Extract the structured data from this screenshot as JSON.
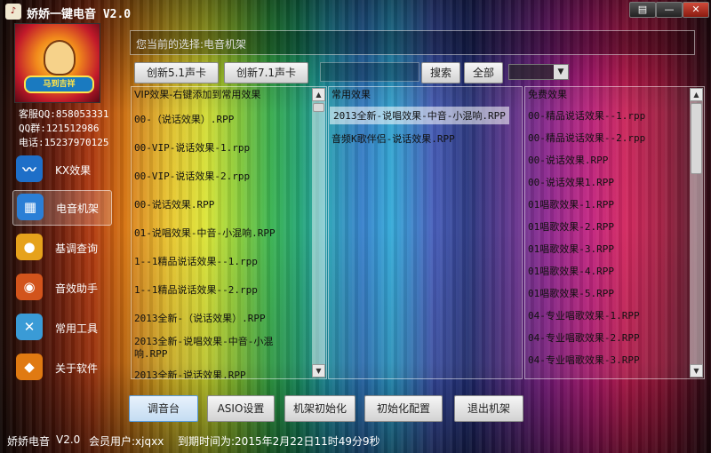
{
  "app": {
    "title": "娇娇一键电音 V2.0",
    "logo_icon": "app-logo-icon",
    "avatar_text": "马到吉祥"
  },
  "window_controls": [
    {
      "name": "menu-icon",
      "glyph": "▤"
    },
    {
      "name": "minimize-icon",
      "glyph": "—"
    },
    {
      "name": "close-icon",
      "glyph": "✕"
    }
  ],
  "contact": {
    "service_qq": "客服QQ:858053331",
    "qq_group": "QQ群:121512986",
    "phone": "电话:15237970125"
  },
  "nav": [
    {
      "label": "KX效果",
      "icon": "wave-icon",
      "glyph": "〰",
      "color": "#1e6fc8",
      "active": false
    },
    {
      "label": "电音机架",
      "icon": "rack-icon",
      "glyph": "▦",
      "color": "#2b7fd6",
      "active": true
    },
    {
      "label": "基调查询",
      "icon": "bulb-icon",
      "glyph": "●",
      "color": "#e6a21c",
      "active": false
    },
    {
      "label": "音效助手",
      "icon": "disc-icon",
      "glyph": "◉",
      "color": "#d2541c",
      "active": false
    },
    {
      "label": "常用工具",
      "icon": "tools-icon",
      "glyph": "✕",
      "color": "#3a9bd6",
      "active": false
    },
    {
      "label": "关于软件",
      "icon": "tag-icon",
      "glyph": "◆",
      "color": "#e07a12",
      "active": false
    }
  ],
  "selection": {
    "text": "您当前的选择:电音机架"
  },
  "toolbar": {
    "innov51": "创新5.1声卡",
    "innov71": "创新7.1声卡",
    "search": "搜索",
    "all": "全部"
  },
  "panels": {
    "vip": {
      "header": "VIP效果-右键添加到常用效果",
      "items": [
        "00-（说话效果）.RPP",
        "00-VIP-说话效果-1.rpp",
        "00-VIP-说话效果-2.rpp",
        "00-说话效果.RPP",
        "01-说唱效果-中音-小混响.RPP",
        "1--1精品说话效果--1.rpp",
        "1--1精品说话效果--2.rpp",
        "2013全新-（说话效果）.RPP",
        "2013全新-说唱效果-中音-小混",
        "响.RPP",
        "2013全新-说话效果.RPP"
      ]
    },
    "common": {
      "header": "常用效果",
      "items": [
        "2013全新-说唱效果-中音-小混响.RPP",
        "音频K歌伴侣-说话效果.RPP"
      ],
      "selected_index": 0
    },
    "free": {
      "header": "免费效果",
      "items": [
        "00-精品说话效果--1.rpp",
        "00-精品说话效果--2.rpp",
        "00-说话效果.RPP",
        "00-说话效果1.RPP",
        "01唱歌效果-1.RPP",
        "01唱歌效果-2.RPP",
        "01唱歌效果-3.RPP",
        "01唱歌效果-4.RPP",
        "01唱歌效果-5.RPP",
        "04-专业唱歌效果-1.RPP",
        "04-专业唱歌效果-2.RPP",
        "04-专业唱歌效果-3.RPP"
      ]
    }
  },
  "bottom_buttons": [
    "调音台",
    "ASIO设置",
    "机架初始化",
    "初始化配置",
    "退出机架"
  ],
  "status": {
    "app_name": "娇娇电音",
    "version": "V2.0",
    "member": "会员用户:xjqxx",
    "expiry": "到期时间为:2015年2月22日11时49分9秒"
  }
}
